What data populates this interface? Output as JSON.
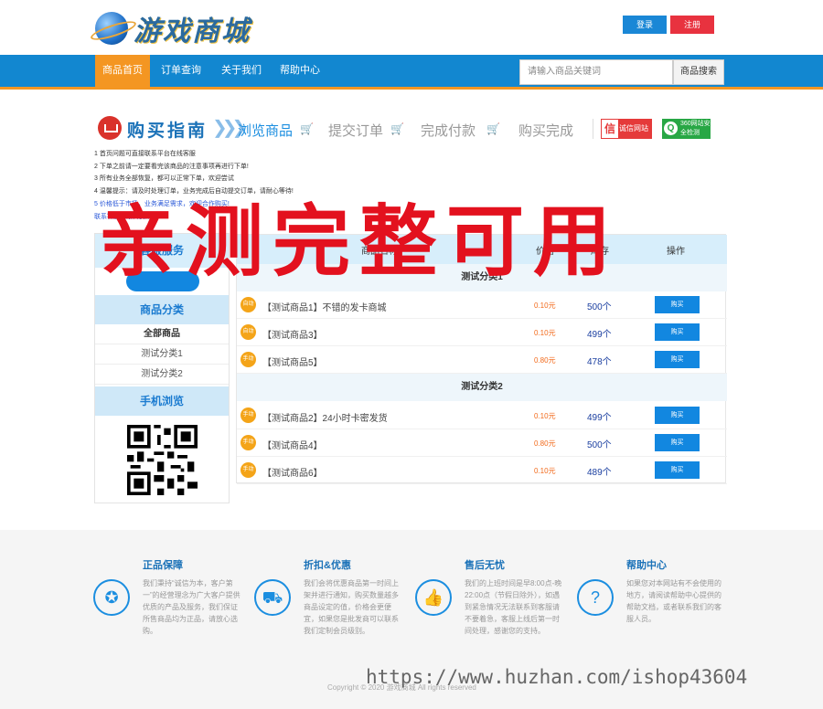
{
  "header": {
    "logo_text": "游戏商城",
    "login_label": "登录",
    "register_label": "注册"
  },
  "nav": {
    "items": [
      "商品首页",
      "订单查询",
      "关于我们",
      "帮助中心"
    ],
    "search_placeholder": "请输入商品关键词",
    "search_button": "商品搜索"
  },
  "guide": {
    "title": "购买指南",
    "steps": [
      "浏览商品",
      "提交订单",
      "完成付款",
      "购买完成"
    ],
    "badge1": "诚信网站",
    "badge1_icon": "信",
    "badge2": "360网站安全检测",
    "notes": [
      "1  首页问题可直接联系平台在线客服",
      "2  下单之前请一定要看完该商品的注意事项再进行下单!",
      "3  所有业务全部恢复，都可以正常下单，欢迎尝试",
      "4  温馨提示：请及时处理订单，业务完成后自动提交订单，请耐心等待!",
      "5  价格低于市场，业务满足需求，欢迎合作购买!",
      "联系客服  退款  付款"
    ]
  },
  "sidebar": {
    "head": "客服服务",
    "category_title": "商品分类",
    "categories": [
      "全部商品",
      "测试分类1",
      "测试分类2"
    ],
    "mobile_title": "手机浏览"
  },
  "table": {
    "headers": [
      "商品名称",
      "价格",
      "库存",
      "操作"
    ],
    "groups": [
      {
        "name": "测试分类1",
        "rows": [
          {
            "tag": "自动",
            "name": "【测试商品1】不错的发卡商城",
            "price": "0.10元",
            "stock": "500个",
            "buy": "购买"
          },
          {
            "tag": "自动",
            "name": "【测试商品3】",
            "price": "0.10元",
            "stock": "499个",
            "buy": "购买"
          },
          {
            "tag": "手动",
            "name": "【测试商品5】",
            "price": "0.80元",
            "stock": "478个",
            "buy": "购买"
          }
        ]
      },
      {
        "name": "测试分类2",
        "rows": [
          {
            "tag": "手动",
            "name": "【测试商品2】24小时卡密发货",
            "price": "0.10元",
            "stock": "499个",
            "buy": "购买"
          },
          {
            "tag": "手动",
            "name": "【测试商品4】",
            "price": "0.80元",
            "stock": "500个",
            "buy": "购买"
          },
          {
            "tag": "手动",
            "name": "【测试商品6】",
            "price": "0.10元",
            "stock": "489个",
            "buy": "购买"
          }
        ]
      }
    ]
  },
  "watermark": "亲测完整可用",
  "footer": {
    "features": [
      {
        "title": "正品保障",
        "icon": "award-icon",
        "glyph": "✪",
        "text": "我们秉持“诚信为本，客户第一”的经营理念为广大客户提供优质的产品及服务，我们保证所售商品均为正品，请放心选购。"
      },
      {
        "title": "折扣&优惠",
        "icon": "truck-icon",
        "glyph": "⛟",
        "text": "我们会将优惠商品第一时间上架并进行通知，购买数量越多商品设定的值，价格会更便宜，如果您是批发商可以联系我们定制会员级别。"
      },
      {
        "title": "售后无忧",
        "icon": "thumbs-up-icon",
        "glyph": "👍",
        "text": "我们的上班时间是早8:00点-晚22:00点（节假日除外），如遇到紧急情况无法联系到客服请不要着急，客服上线后第一时间处理，感谢您的支持。"
      },
      {
        "title": "帮助中心",
        "icon": "question-icon",
        "glyph": "?",
        "text": "如果您对本网站有不会使用的地方，请阅读帮助中心提供的帮助文档，或者联系我们的客服人员。"
      }
    ],
    "copyright": "Copyright © 2020 游戏商城 All rights reserved",
    "url_mark": "https://www.huzhan.com/ishop43604"
  },
  "colors": {
    "nav_blue": "#1287d0",
    "accent_orange": "#f49622",
    "button_blue": "#1287e0",
    "register_red": "#e8323f",
    "watermark_red": "#e3111e"
  }
}
